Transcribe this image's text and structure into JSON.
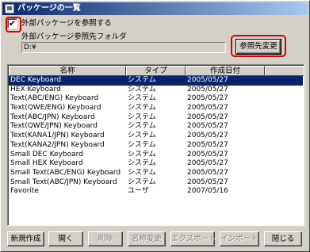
{
  "window": {
    "title": "パッケージの一覧"
  },
  "external": {
    "checkbox_label": "外部パッケージを参照する",
    "checked": "✔",
    "folder_label": "外部パッケージ参照先フォルダ",
    "folder_value": "D:¥",
    "browse_button": "参照先変更"
  },
  "list": {
    "columns": [
      "名称",
      "タイプ",
      "作成日付"
    ],
    "rows": [
      {
        "name": "DEC Keyboard",
        "type": "システム",
        "date": "2005/05/27",
        "selected": true
      },
      {
        "name": "HEX Keyboard",
        "type": "システム",
        "date": "2005/05/27"
      },
      {
        "name": "Text(ABC/ENG) Keyboard",
        "type": "システム",
        "date": "2005/05/27"
      },
      {
        "name": "Text(QWE/ENG) Keyboard",
        "type": "システム",
        "date": "2005/05/27"
      },
      {
        "name": "Text(ABC/JPN) Keyboard",
        "type": "システム",
        "date": "2005/05/27"
      },
      {
        "name": "Text(QWE/JPN) Keyboard",
        "type": "システム",
        "date": "2005/05/27"
      },
      {
        "name": "Text(KANA1/JPN) Keyboard",
        "type": "システム",
        "date": "2005/05/27"
      },
      {
        "name": "Text(KANA2/JPN) Keyboard",
        "type": "システム",
        "date": "2005/05/27"
      },
      {
        "name": "Small DEC Keyboard",
        "type": "システム",
        "date": "2005/05/27"
      },
      {
        "name": "Small HEX Keyboard",
        "type": "システム",
        "date": "2005/05/27"
      },
      {
        "name": "Small Text(ABC/ENG) Keyboard",
        "type": "システム",
        "date": "2005/05/27"
      },
      {
        "name": "Small Text(ABC/JPN) Keyboard",
        "type": "システム",
        "date": "2005/05/27"
      },
      {
        "name": "Favorite",
        "type": "ユーザ",
        "date": "2007/05/16"
      }
    ]
  },
  "buttons": {
    "new": "新規作成",
    "open": "開く",
    "delete": "削除",
    "rename": "名称変更",
    "export": "エクスポート",
    "import": "インポート",
    "close": "閉じる"
  }
}
